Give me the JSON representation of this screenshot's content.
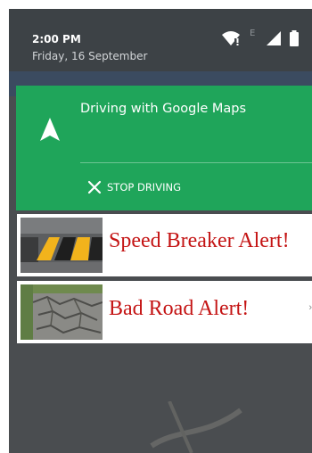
{
  "status_bar": {
    "time": "2:00 PM",
    "date": "Friday, 16 September",
    "network_type": "E"
  },
  "maps_notification": {
    "title": "Driving with Google Maps",
    "action_label": "STOP DRIVING",
    "accent_color": "#1fa55a"
  },
  "alerts": [
    {
      "text": "Speed Breaker Alert!",
      "image": "speed-breaker-photo"
    },
    {
      "text": "Bad Road Alert!",
      "image": "bad-road-photo",
      "edge_char": "›"
    }
  ],
  "colors": {
    "alert_text": "#c41414",
    "shade": "#4a4d50"
  }
}
